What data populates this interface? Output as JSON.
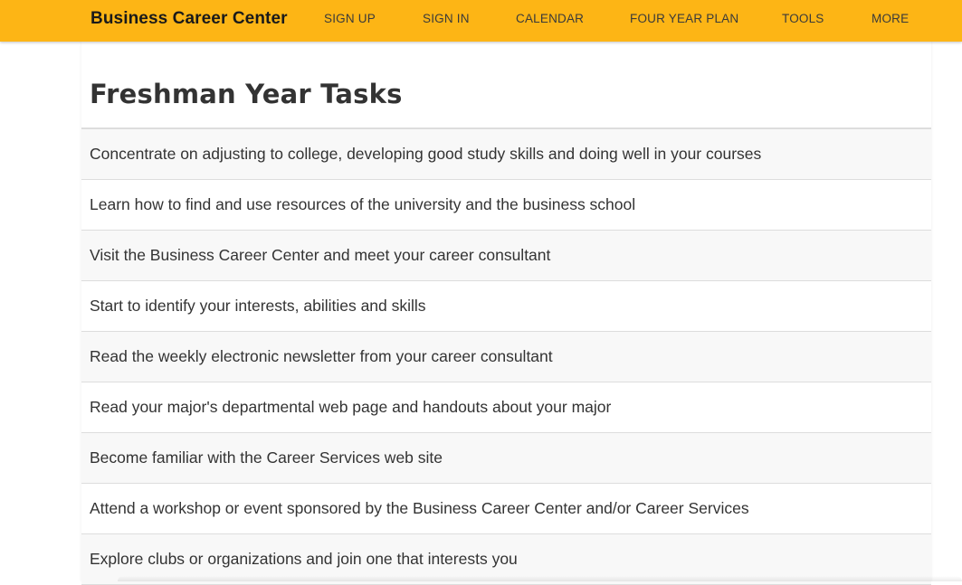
{
  "navbar": {
    "brand": "Business Career Center",
    "links": [
      "SIGN UP",
      "SIGN IN",
      "CALENDAR",
      "FOUR YEAR PLAN",
      "TOOLS",
      "MORE"
    ],
    "accent_color": "#fdb515"
  },
  "main": {
    "title": "Freshman Year Tasks",
    "tasks": [
      "Concentrate on adjusting to college, developing good study skills and doing well in your courses",
      "Learn how to find and use resources of the university and the business school",
      "Visit the Business Career Center and meet your career consultant",
      "Start to identify your interests, abilities and skills",
      "Read the weekly electronic newsletter from your career consultant",
      "Read your major's departmental web page and handouts about your major",
      "Become familiar with the Career Services web site",
      "Attend a workshop or event sponsored by the Business Career Center and/or Career Services",
      "Explore clubs or organizations and join one that interests you"
    ]
  }
}
